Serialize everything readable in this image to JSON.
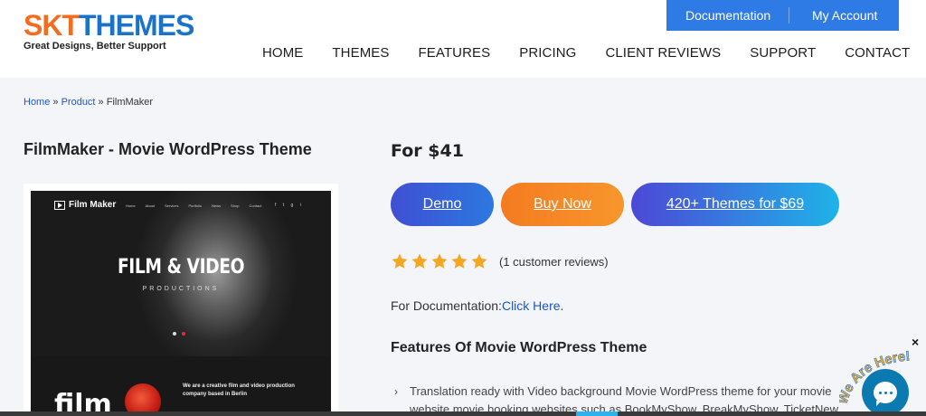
{
  "header": {
    "logo": {
      "skt": "SKT",
      "themes": "THEMES",
      "tagline": "Great Designs, Better Support"
    },
    "topbar": {
      "documentation": "Documentation",
      "my_account": "My Account"
    },
    "nav": [
      "HOME",
      "THEMES",
      "FEATURES",
      "PRICING",
      "CLIENT REVIEWS",
      "SUPPORT",
      "CONTACT"
    ]
  },
  "breadcrumb": {
    "home": "Home",
    "sep": " » ",
    "product": "Product",
    "current": "FilmMaker"
  },
  "product": {
    "title": "FilmMaker - Movie WordPress Theme",
    "preview": {
      "logo": "Film Maker",
      "links": [
        "Home",
        "About",
        "Services",
        "Portfolio",
        "News",
        "Shop",
        "Contact"
      ],
      "social": "f t g i",
      "hero_title": "FILM & VIDEO",
      "hero_sub": "PRODUCTIONS",
      "film_word": "film",
      "lower_text": "We are a creative film and video production company based in Berlin"
    }
  },
  "purchase": {
    "price": "For $41",
    "buttons": {
      "demo": "Demo",
      "buy": "Buy Now",
      "bundle": "420+ Themes for $69"
    },
    "rating": {
      "stars": 5,
      "reviews": "(1 customer reviews)"
    },
    "documentation": {
      "label": "For Documentation:",
      "link": "Click Here",
      "suffix": "."
    }
  },
  "features": {
    "title": "Features Of Movie WordPress Theme",
    "items": [
      "Translation ready with Video background Movie WordPress theme for your movie website movie booking websites such as BookMyShow, BreakMyShow, TicketNew, CinemaBlend"
    ]
  },
  "chat": {
    "badge": "We Are Here!",
    "close": "×"
  },
  "colors": {
    "brand_orange": "#f36d21",
    "brand_blue": "#1a73c8",
    "topbar": "#2f7be5",
    "star": "#f5a623",
    "chat": "#0a7ab0"
  }
}
